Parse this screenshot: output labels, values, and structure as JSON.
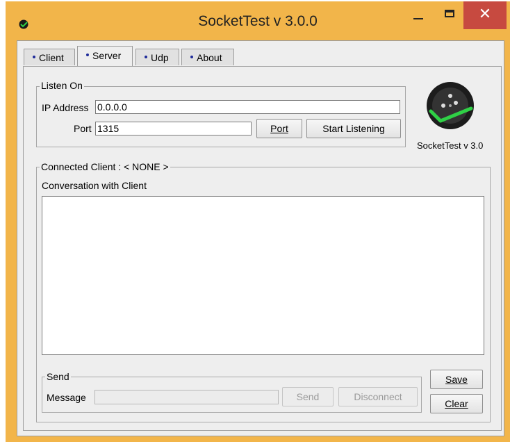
{
  "window": {
    "title": "SocketTest v 3.0.0"
  },
  "tabs": [
    {
      "label": "Client"
    },
    {
      "label": "Server"
    },
    {
      "label": "Udp"
    },
    {
      "label": "About"
    }
  ],
  "listen": {
    "legend": "Listen On",
    "ip_label": "IP Address",
    "ip_value": "0.0.0.0",
    "port_label": "Port",
    "port_value": "1315",
    "port_button": "Port",
    "start_button": "Start Listening"
  },
  "logo": {
    "caption": "SocketTest v 3.0"
  },
  "connected": {
    "legend": "Connected Client : < NONE >",
    "conversation_label": "Conversation with Client"
  },
  "send": {
    "legend": "Send",
    "message_label": "Message",
    "message_value": "",
    "send_button": "Send",
    "disconnect_button": "Disconnect"
  },
  "actions": {
    "save": "Save",
    "clear": "Clear"
  },
  "colors": {
    "titlebar": "#f2b54a",
    "close": "#c74a40",
    "tab_dot": "#1e2b9a",
    "logo_check": "#2fd146"
  }
}
